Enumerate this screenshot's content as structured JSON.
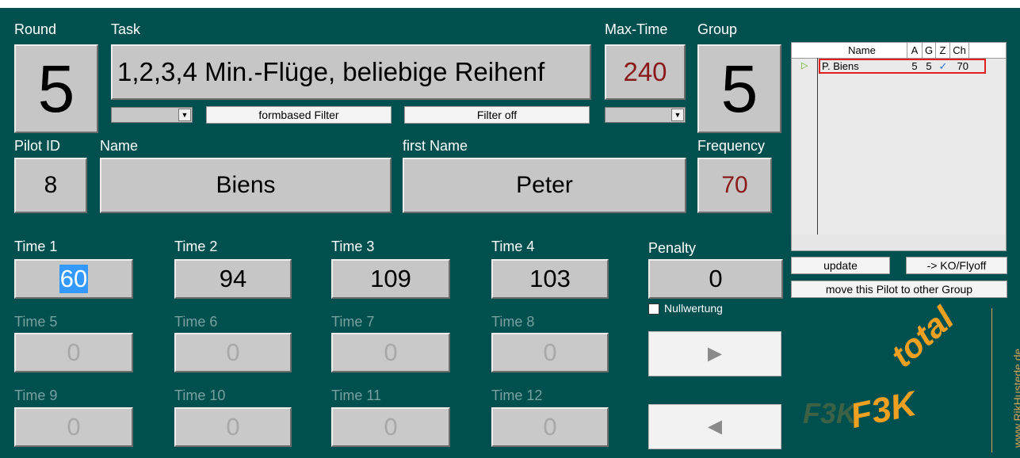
{
  "round": {
    "label": "Round",
    "value": "5"
  },
  "task": {
    "label": "Task",
    "value": "1,2,3,4 Min.-Flüge, beliebige Reihenf",
    "filter_button": "formbased Filter",
    "filter_off_button": "Filter off"
  },
  "max_time": {
    "label": "Max-Time",
    "value": "240"
  },
  "group": {
    "label": "Group",
    "value": "5"
  },
  "pilot": {
    "id_label": "Pilot ID",
    "id": "8",
    "name_label": "Name",
    "name": "Biens",
    "first_name_label": "first Name",
    "first_name": "Peter",
    "frequency_label": "Frequency",
    "frequency": "70"
  },
  "times": [
    {
      "label": "Time 1",
      "value": "60",
      "enabled": true
    },
    {
      "label": "Time 2",
      "value": "94",
      "enabled": true
    },
    {
      "label": "Time 3",
      "value": "109",
      "enabled": true
    },
    {
      "label": "Time 4",
      "value": "103",
      "enabled": true
    },
    {
      "label": "Time 5",
      "value": "0",
      "enabled": false
    },
    {
      "label": "Time 6",
      "value": "0",
      "enabled": false
    },
    {
      "label": "Time 7",
      "value": "0",
      "enabled": false
    },
    {
      "label": "Time 8",
      "value": "0",
      "enabled": false
    },
    {
      "label": "Time 9",
      "value": "0",
      "enabled": false
    },
    {
      "label": "Time 10",
      "value": "0",
      "enabled": false
    },
    {
      "label": "Time 11",
      "value": "0",
      "enabled": false
    },
    {
      "label": "Time 12",
      "value": "0",
      "enabled": false
    }
  ],
  "penalty": {
    "label": "Penalty",
    "value": "0",
    "nullwertung_label": "Nullwertung",
    "nullwertung_checked": false
  },
  "grid": {
    "columns": [
      "Name",
      "A",
      "G",
      "Z",
      "Ch"
    ],
    "rows": [
      {
        "name": "P. Biens",
        "a": "5",
        "g": "5",
        "z": "✓",
        "ch": "70"
      }
    ]
  },
  "buttons": {
    "update": "update",
    "ko_flyoff": "-> KO/Flyoff",
    "move_pilot": "move this Pilot to other Group",
    "next_glyph": "►",
    "prev_glyph": "◄"
  },
  "logo": {
    "ghost_text": "F3K",
    "main_text": "F3K",
    "total_text": "total",
    "url": "www.RikHustede.de"
  },
  "colors": {
    "background": "#005050",
    "field": "#c6c6c6",
    "red_value": "#8b1a1a",
    "highlight": "#3399ff",
    "grid_selection": "#e02020",
    "logo_orange": "#f0a020"
  }
}
